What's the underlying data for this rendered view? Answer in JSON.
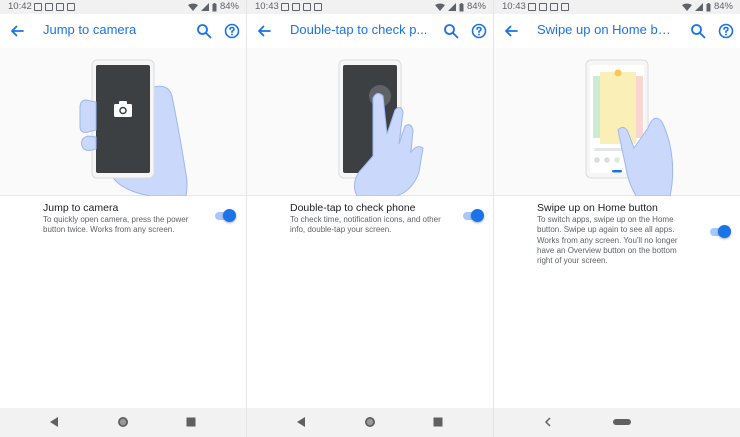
{
  "status_bar": {
    "battery_text": "84%",
    "times": [
      "10:42",
      "10:43",
      "10:43"
    ]
  },
  "panels": [
    {
      "title": "Jump to camera",
      "setting_title": "Jump to camera",
      "setting_desc": "To quickly open camera, press the power button twice. Works from any screen.",
      "toggle_on": true,
      "nav_style": "three-button"
    },
    {
      "title": "Double-tap to check p...",
      "setting_title": "Double-tap to check phone",
      "setting_desc": "To check time, notification icons, and other info, double-tap your screen.",
      "toggle_on": true,
      "nav_style": "three-button"
    },
    {
      "title": "Swipe up on Home butt...",
      "setting_title": "Swipe up on Home button",
      "setting_desc": "To switch apps, swipe up on the Home button. Swipe up again to see all apps. Works from any screen. You'll no longer have an Overview button on the bottom right of your screen.",
      "toggle_on": true,
      "nav_style": "gesture-pill"
    }
  ],
  "icons": {
    "back": "arrow-back-icon",
    "search": "search-icon",
    "help": "help-circle-icon",
    "wifi": "wifi-icon",
    "cell": "cell-signal-icon",
    "battery": "battery-icon",
    "camera": "camera-icon"
  },
  "colors": {
    "accent": "#1a73e8",
    "toggle_track": "#a8c7fa",
    "hand": "#c9d8fb",
    "hand_outline": "#9db7f2",
    "phone_screen": "#3c4043"
  }
}
